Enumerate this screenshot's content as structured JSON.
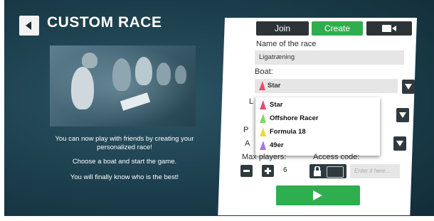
{
  "header": {
    "title": "CUSTOM RACE"
  },
  "left": {
    "line1": "You can now play with friends by creating your",
    "line2": "personalized race!",
    "line3": "Choose a boat and start the game.",
    "line4": "You will finally know who is the best!"
  },
  "tabs": {
    "join": "Join",
    "create": "Create",
    "video_icon": "video-camera-icon"
  },
  "form": {
    "name_label": "Name of the race",
    "name_value": "Ligatræning",
    "boat_label": "Boat:",
    "boat_value": "Star",
    "boat_options": [
      "Star",
      "Offshore Racer",
      "Formula 18",
      "49er"
    ],
    "max_players_label": "Max players:",
    "max_players_value": "6",
    "access_code_label": "Access code:",
    "access_code_placeholder": "Enter it here..."
  },
  "colors": {
    "accent": "#2fae4f",
    "dark": "#2d3438",
    "background": "#1b3d4b"
  }
}
